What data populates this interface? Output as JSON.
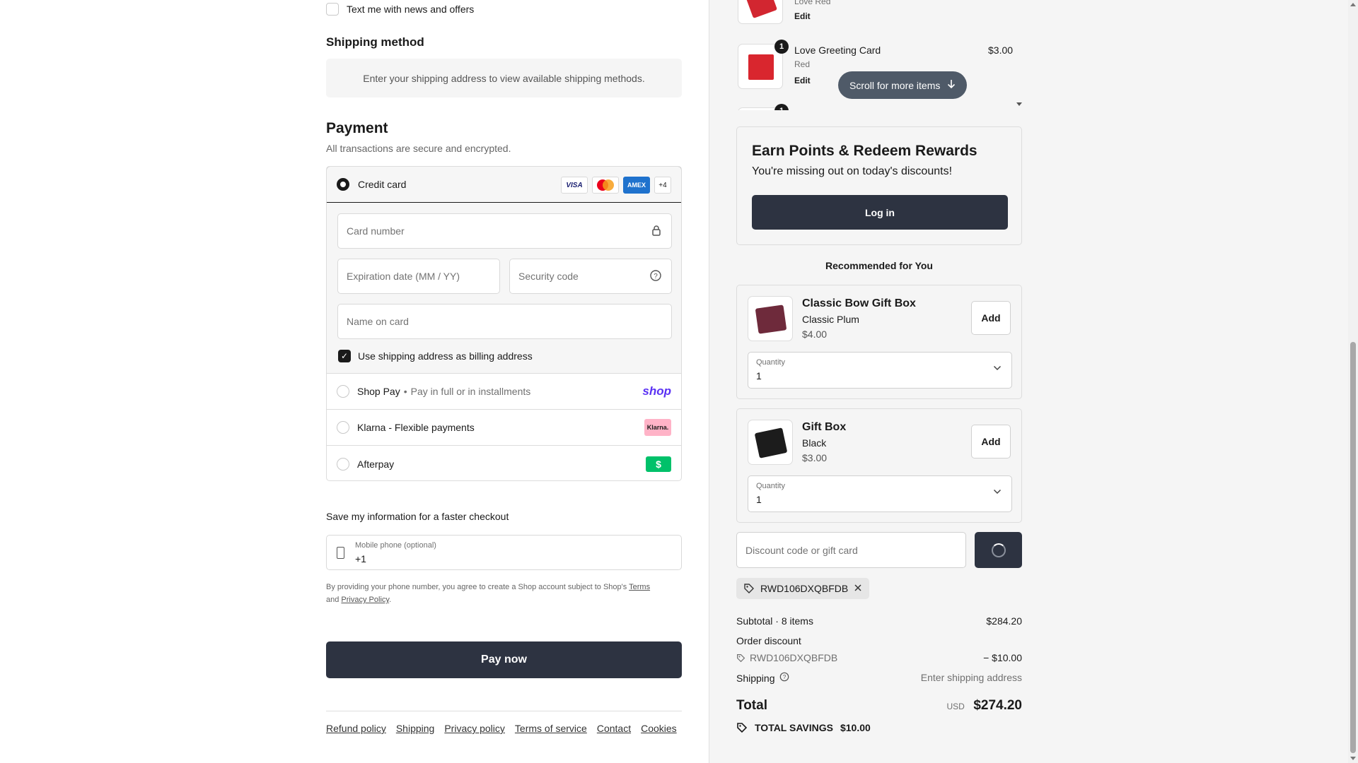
{
  "marketing": {
    "sms_label": "Text me with news and offers"
  },
  "shipping_method": {
    "title": "Shipping method",
    "placeholder_text": "Enter your shipping address to view available shipping methods."
  },
  "payment": {
    "title": "Payment",
    "subtitle": "All transactions are secure and encrypted.",
    "credit_card": {
      "label": "Credit card",
      "brands": [
        "VISA",
        "Mastercard",
        "AMEX",
        "+4"
      ],
      "card_number_placeholder": "Card number",
      "expiry_placeholder": "Expiration date (MM / YY)",
      "security_placeholder": "Security code",
      "name_placeholder": "Name on card",
      "billing_label": "Use shipping address as billing address"
    },
    "methods": [
      {
        "label": "Shop Pay",
        "sub": "Pay in full or in installments",
        "logo": "shop"
      },
      {
        "label": "Klarna - Flexible payments",
        "sub": "",
        "logo": "Klarna."
      },
      {
        "label": "Afterpay",
        "sub": "",
        "logo": "$"
      }
    ]
  },
  "save_info": {
    "title": "Save my information for a faster checkout",
    "phone_label": "Mobile phone (optional)",
    "phone_value": "+1",
    "legal_prefix": "By providing your phone number, you agree to create a Shop account subject to Shop's",
    "terms_link": "Terms",
    "and": "and",
    "privacy_link": "Privacy Policy",
    "period": "."
  },
  "pay_now": "Pay now",
  "footer_links": [
    "Refund policy",
    "Shipping",
    "Privacy policy",
    "Terms of service",
    "Contact",
    "Cookies"
  ],
  "order_items": [
    {
      "name": "",
      "variant": "Love Red",
      "edit": "Edit",
      "price": "",
      "qty": ""
    },
    {
      "name": "Love Greeting Card",
      "variant": "Red",
      "edit": "Edit",
      "price": "$3.00",
      "qty": "1"
    },
    {
      "name": "",
      "variant": "",
      "edit": "",
      "price": "",
      "qty": "1"
    }
  ],
  "scroll_pill": "Scroll for more items",
  "rewards": {
    "title": "Earn Points & Redeem Rewards",
    "subtitle": "You're missing out on today's discounts!",
    "button": "Log in"
  },
  "recommended": {
    "title": "Recommended for You",
    "items": [
      {
        "name": "Classic Bow Gift Box",
        "variant": "Classic Plum",
        "price": "$4.00",
        "add": "Add",
        "qty_label": "Quantity",
        "qty": "1"
      },
      {
        "name": "Gift Box",
        "variant": "Black",
        "price": "$3.00",
        "add": "Add",
        "qty_label": "Quantity",
        "qty": "1"
      }
    ]
  },
  "discount": {
    "placeholder": "Discount code or gift card",
    "applied_code": "RWD106DXQBFDB"
  },
  "summary": {
    "subtotal_label": "Subtotal · 8 items",
    "subtotal_value": "$284.20",
    "order_discount_label": "Order discount",
    "discount_code": "RWD106DXQBFDB",
    "discount_value": "− $10.00",
    "shipping_label": "Shipping",
    "shipping_value": "Enter shipping address",
    "total_label": "Total",
    "currency": "USD",
    "total_value": "$274.20",
    "savings_label": "TOTAL SAVINGS",
    "savings_value": "$10.00"
  },
  "colors": {
    "primary_button": "#2d3341",
    "shop_pay": "#5a31f4",
    "klarna": "#ffb3c7",
    "afterpay": "#00c16a",
    "amex": "#1f72cd"
  }
}
